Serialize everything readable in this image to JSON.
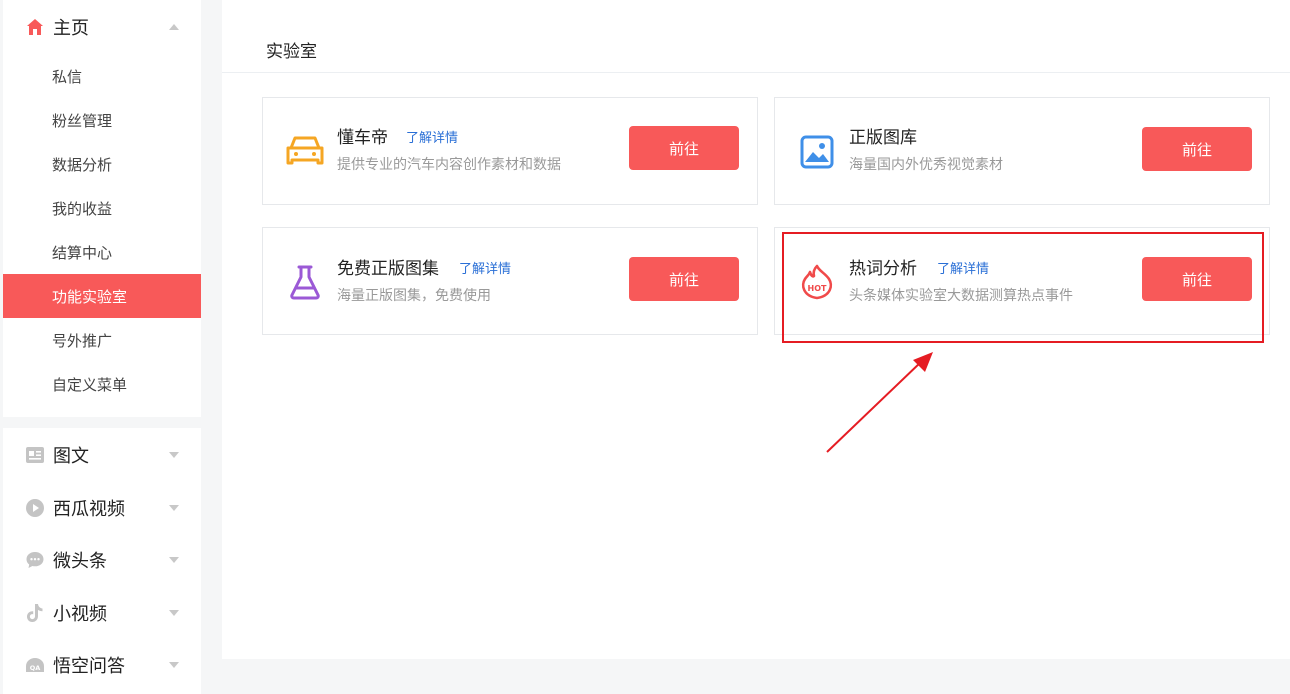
{
  "sidebar": {
    "home": {
      "label": "主页",
      "icon": "home-icon"
    },
    "sub_items": [
      {
        "label": "私信",
        "active": false
      },
      {
        "label": "粉丝管理",
        "active": false
      },
      {
        "label": "数据分析",
        "active": false
      },
      {
        "label": "我的收益",
        "active": false
      },
      {
        "label": "结算中心",
        "active": false
      },
      {
        "label": "功能实验室",
        "active": true
      },
      {
        "label": "号外推广",
        "active": false
      },
      {
        "label": "自定义菜单",
        "active": false
      }
    ],
    "sections": [
      {
        "label": "图文",
        "icon": "article-icon"
      },
      {
        "label": "西瓜视频",
        "icon": "video-play-icon"
      },
      {
        "label": "微头条",
        "icon": "chat-bubble-icon"
      },
      {
        "label": "小视频",
        "icon": "tiktok-note-icon"
      },
      {
        "label": "悟空问答",
        "icon": "qa-icon"
      }
    ]
  },
  "main": {
    "title": "实验室",
    "cards": [
      {
        "title": "懂车帝",
        "link": "了解详情",
        "desc": "提供专业的汽车内容创作素材和数据",
        "button": "前往",
        "icon": "car-icon",
        "icon_color": "#f5a623"
      },
      {
        "title": "正版图库",
        "link": "",
        "desc": "海量国内外优秀视觉素材",
        "button": "前往",
        "icon": "image-gallery-icon",
        "icon_color": "#3f8fe8"
      },
      {
        "title": "免费正版图集",
        "link": "了解详情",
        "desc": "海量正版图集，免费使用",
        "button": "前往",
        "icon": "flask-icon",
        "icon_color": "#9b59d6"
      },
      {
        "title": "热词分析",
        "link": "了解详情",
        "desc": "头条媒体实验室大数据测算热点事件",
        "button": "前往",
        "icon": "hot-fire-icon",
        "icon_color": "#f04a4a"
      }
    ]
  },
  "colors": {
    "accent": "#f85959",
    "link": "#2a6fd6",
    "annotation": "#e51c23"
  }
}
